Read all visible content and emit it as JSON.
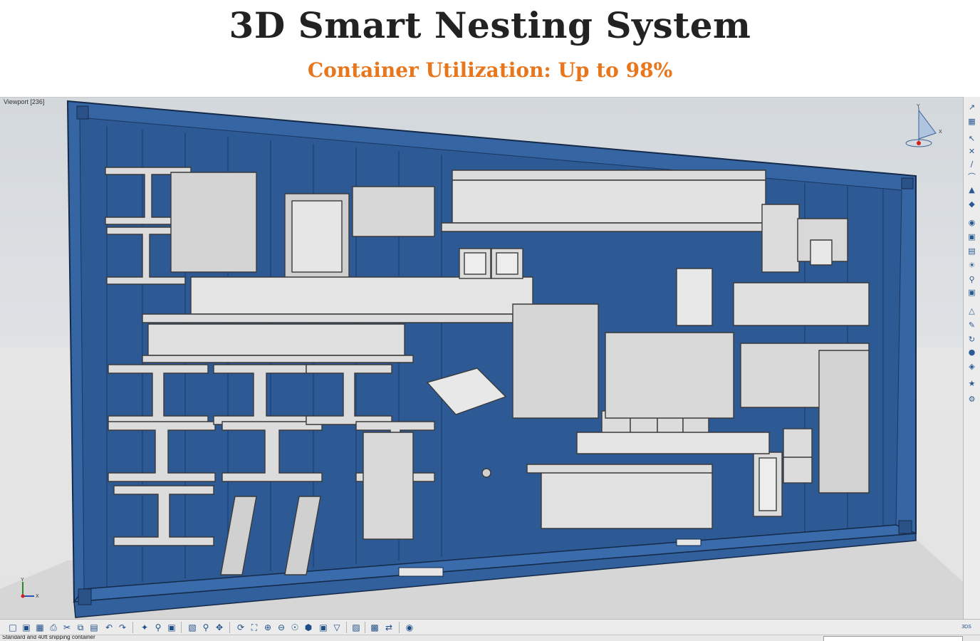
{
  "header": {
    "title": "3D Smart Nesting System",
    "subtitle": "Container Utilization: Up to 98%"
  },
  "viewport": {
    "label": "Viewport [236]"
  },
  "compass": {
    "axis_y": "Y",
    "axis_x": "X"
  },
  "axis_indicator": {
    "axis_y": "Y",
    "axis_x": "X"
  },
  "right_toolbar": {
    "icons": [
      "measure-icon",
      "grid-icon",
      "select-icon",
      "snap-icon",
      "line-icon",
      "arc-icon",
      "paint-icon",
      "shade-icon",
      "render-icon",
      "view-icon",
      "layer-icon",
      "light-icon",
      "zoom-icon",
      "camera-icon",
      "plane-icon",
      "edit-icon",
      "rotate-icon",
      "sphere-icon",
      "material-icon",
      "extra-icon",
      "settings-icon"
    ]
  },
  "bottom_toolbar": {
    "icons": [
      "new-file-icon",
      "open-folder-icon",
      "save-icon",
      "print-icon",
      "cut-icon",
      "copy-icon",
      "paste-icon",
      "undo-icon",
      "redo-icon",
      "fly-icon",
      "search-icon",
      "snapshot-icon",
      "sketch-icon",
      "zoom-area-icon",
      "pan-icon",
      "rotate-view-icon",
      "fit-all-icon",
      "zoom-in-icon",
      "zoom-out-icon",
      "normal-view-icon",
      "iso-view-icon",
      "shading-icon",
      "filter-icon",
      "hide-icon",
      "swap-icon",
      "apply-material-icon"
    ],
    "logo": "3DS"
  },
  "status": {
    "text": "Standard and 40ft shipping container",
    "input_value": ""
  },
  "colors": {
    "title": "#222222",
    "subtitle": "#e8761c",
    "container_blue": "#3565a3",
    "steel_grey": "#dcdcdc"
  }
}
